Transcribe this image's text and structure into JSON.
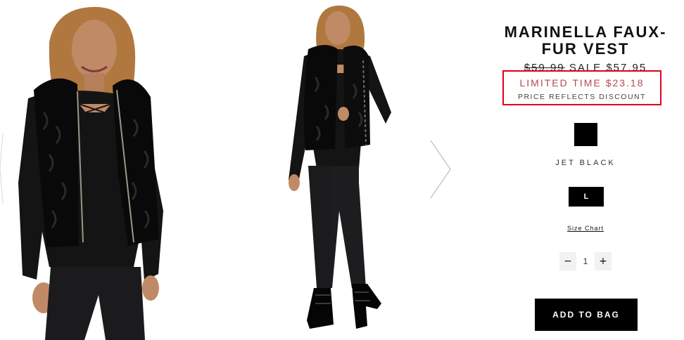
{
  "gallery": {
    "photos": [
      {
        "icon": "product-photo-front"
      },
      {
        "icon": "product-photo-full-body"
      }
    ],
    "prev_icon": "chevron-left-icon",
    "next_icon": "chevron-right-icon"
  },
  "product": {
    "title_line1": "MARINELLA FAUX-",
    "title_line2": "FUR VEST",
    "original_price": "$59.99",
    "sale_label": "SALE",
    "sale_price": "$57.95",
    "limited_label": "LIMITED TIME",
    "limited_price": "$23.18",
    "discount_note": "PRICE REFLECTS DISCOUNT",
    "color_name": "JET BLACK",
    "swatch_color": "#000000",
    "size": "L",
    "size_chart": "Size Chart",
    "quantity": "1",
    "qty_decrease": "−",
    "qty_increase": "+",
    "add_to_bag": "ADD TO BAG"
  },
  "colors": {
    "highlight_border": "#e0001a",
    "limited_text": "#b5494f",
    "button_bg": "#000000"
  }
}
